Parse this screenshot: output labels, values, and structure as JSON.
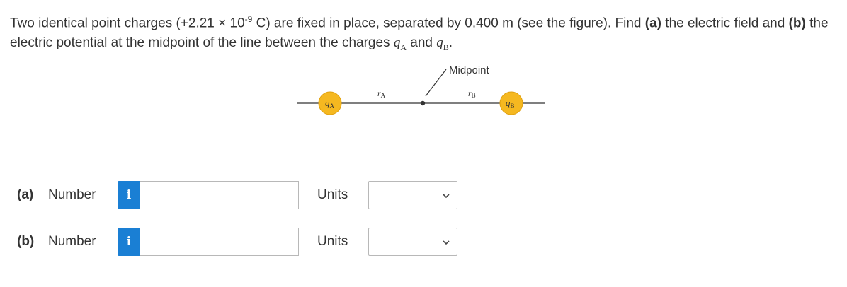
{
  "question": {
    "intro": "Two identical point charges (+2.21 × 10",
    "exponent": "-9",
    "after_exponent": " C) are fixed in place, separated by 0.400 m (see the figure). Find ",
    "part_a_marker": "(a)",
    "part_a_text": " the electric field and ",
    "part_b_marker": "(b)",
    "part_b_text": " the electric potential at the midpoint of the line between the charges ",
    "qa_symbol": "q",
    "qa_sub": "A",
    "and_text": " and ",
    "qb_symbol": "q",
    "qb_sub": "B",
    "end": "."
  },
  "figure": {
    "midpoint_label": "Midpoint",
    "qa_label": "q",
    "qa_sub": "A",
    "qb_label": "q",
    "qb_sub": "B",
    "ra_label": "r",
    "ra_sub": "A",
    "rb_label": "r",
    "rb_sub": "B",
    "charge_color": "#f5b820",
    "charge_stroke": "#e0a010"
  },
  "answers": [
    {
      "part_label": "(a)",
      "number_label": "Number",
      "info_icon_glyph": "i",
      "number_value": "",
      "units_label": "Units",
      "units_value": ""
    },
    {
      "part_label": "(b)",
      "number_label": "Number",
      "info_icon_glyph": "i",
      "number_value": "",
      "units_label": "Units",
      "units_value": ""
    }
  ]
}
